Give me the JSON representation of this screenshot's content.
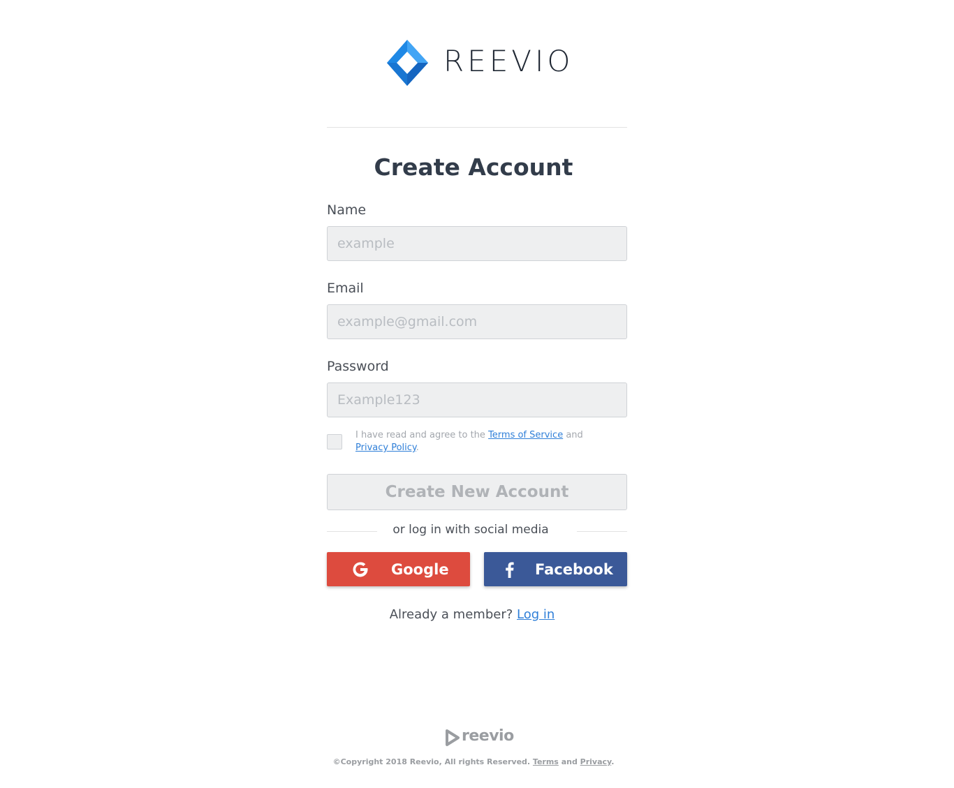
{
  "brand": {
    "name": "REEVIO",
    "footer_name": "reevio",
    "accent": "#1e88e5",
    "accent_dark": "#1565c0"
  },
  "page": {
    "title": "Create Account"
  },
  "form": {
    "name_label": "Name",
    "name_placeholder": "example",
    "email_label": "Email",
    "email_placeholder": "example@gmail.com",
    "password_label": "Password",
    "password_placeholder": "Example123",
    "agree_prefix": "I have read and agree to the ",
    "terms_link": "Terms of Service",
    "agree_middle": " and ",
    "privacy_link": "Privacy Policy",
    "agree_suffix": ".",
    "submit_label": "Create New Account"
  },
  "social": {
    "divider_text": "or log in with social media",
    "google_label": "Google",
    "google_color": "#dd4b3e",
    "facebook_label": "Facebook",
    "facebook_color": "#3b5998"
  },
  "login": {
    "prompt": "Already a member? ",
    "link": "Log in"
  },
  "footer": {
    "copyright": "©Copyright 2018 Reevio, All rights Reserved. ",
    "terms_link": "Terms",
    "and": " and ",
    "privacy_link": "Privacy",
    "suffix": "."
  }
}
